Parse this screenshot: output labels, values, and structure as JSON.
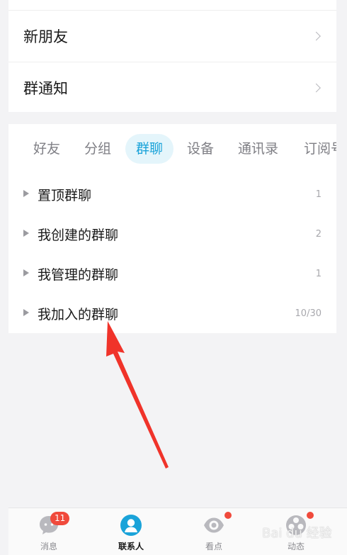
{
  "top_list": [
    {
      "label": "新朋友"
    },
    {
      "label": "群通知"
    }
  ],
  "tabs": [
    {
      "label": "好友",
      "active": false
    },
    {
      "label": "分组",
      "active": false
    },
    {
      "label": "群聊",
      "active": true
    },
    {
      "label": "设备",
      "active": false
    },
    {
      "label": "通讯录",
      "active": false
    },
    {
      "label": "订阅号",
      "active": false
    }
  ],
  "groups": [
    {
      "name": "置顶群聊",
      "count": "1"
    },
    {
      "name": "我创建的群聊",
      "count": "2"
    },
    {
      "name": "我管理的群聊",
      "count": "1"
    },
    {
      "name": "我加入的群聊",
      "count": "10/30"
    }
  ],
  "bottom_nav": [
    {
      "label": "消息",
      "icon": "message-icon",
      "badge": "11"
    },
    {
      "label": "联系人",
      "icon": "contacts-icon",
      "active": true
    },
    {
      "label": "看点",
      "icon": "eye-icon",
      "dot": true
    },
    {
      "label": "动态",
      "icon": "flower-icon",
      "dot": true
    }
  ],
  "watermark": "Bai du 经验",
  "colors": {
    "accent": "#1aa3d9",
    "tab_active_bg": "#e4f5fb",
    "badge": "#f04a3c",
    "arrow": "#f0332a"
  }
}
